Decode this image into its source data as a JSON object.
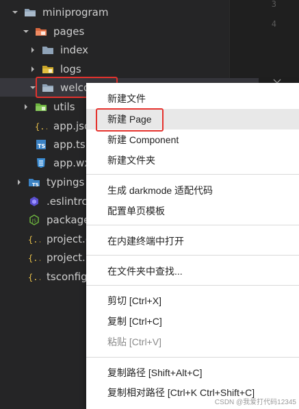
{
  "gutter": {
    "line_numbers": [
      "3",
      "4"
    ]
  },
  "tree": {
    "items": [
      {
        "label": "miniprogram",
        "icon": "folder-open-icon"
      },
      {
        "label": "pages",
        "icon": "folder-pages-icon"
      },
      {
        "label": "index",
        "icon": "folder-icon"
      },
      {
        "label": "logs",
        "icon": "folder-logs-icon"
      },
      {
        "label": "welco",
        "icon": "folder-open-icon"
      },
      {
        "label": "utils",
        "icon": "folder-utils-icon"
      },
      {
        "label": "app.jso",
        "icon": "json-icon"
      },
      {
        "label": "app.ts",
        "icon": "typescript-icon"
      },
      {
        "label": "app.wx",
        "icon": "css-icon"
      },
      {
        "label": "typings",
        "icon": "folder-ts-icon"
      },
      {
        "label": ".eslintrc.",
        "icon": "eslint-icon"
      },
      {
        "label": "package",
        "icon": "nodejs-icon"
      },
      {
        "label": "project.c",
        "icon": "json-icon"
      },
      {
        "label": "project.p",
        "icon": "json-icon"
      },
      {
        "label": "tsconfig",
        "icon": "json-icon"
      }
    ]
  },
  "context_menu": {
    "groups": [
      [
        "新建文件",
        "新建 Page",
        "新建 Component",
        "新建文件夹"
      ],
      [
        "生成 darkmode 适配代码",
        "配置单页模板"
      ],
      [
        "在内建终端中打开"
      ],
      [
        "在文件夹中查找..."
      ],
      [
        "剪切 [Ctrl+X]",
        "复制 [Ctrl+C]",
        "粘贴 [Ctrl+V]"
      ],
      [
        "复制路径 [Shift+Alt+C]",
        "复制相对路径 [Ctrl+K Ctrl+Shift+C]"
      ]
    ],
    "hovered_item": "新建 Page",
    "disabled_item": "粘贴 [Ctrl+V]"
  },
  "watermark": "CSDN @我爱打代码12345",
  "colors": {
    "highlight_box": "#e5322d",
    "folder": "#8fa3b8",
    "json": "#e8c04a",
    "typescript": "#3b82c4",
    "css": "#3d8fd6",
    "eslint": "#5a4fcf",
    "node": "#6db33f"
  }
}
